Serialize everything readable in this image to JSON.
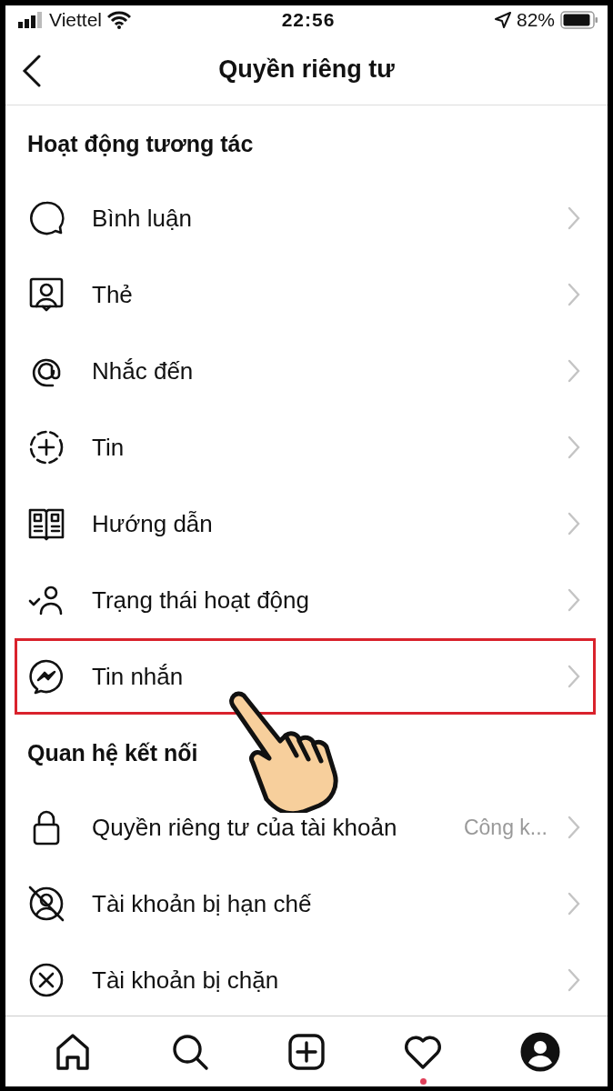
{
  "status_bar": {
    "carrier": "Viettel",
    "time": "22:56",
    "battery": "82%"
  },
  "header": {
    "title": "Quyền riêng tư"
  },
  "sections": [
    {
      "title": "Hoạt động tương tác",
      "items": [
        {
          "kind": "comment",
          "label": "Bình luận",
          "highlighted": false
        },
        {
          "kind": "tag",
          "label": "Thẻ",
          "highlighted": false
        },
        {
          "kind": "mention",
          "label": "Nhắc đến",
          "highlighted": false
        },
        {
          "kind": "story",
          "label": "Tin",
          "highlighted": false
        },
        {
          "kind": "guide",
          "label": "Hướng dẫn",
          "highlighted": false
        },
        {
          "kind": "activity",
          "label": "Trạng thái hoạt động",
          "highlighted": false
        },
        {
          "kind": "messenger",
          "label": "Tin nhắn",
          "highlighted": true
        }
      ]
    },
    {
      "title": "Quan hệ kết nối",
      "items": [
        {
          "kind": "lock",
          "label": "Quyền riêng tư của tài khoản",
          "value": "Công k...",
          "highlighted": false
        },
        {
          "kind": "restricted",
          "label": "Tài khoản bị hạn chế",
          "highlighted": false
        },
        {
          "kind": "blocked",
          "label": "Tài khoản bị chặn",
          "highlighted": false
        }
      ]
    }
  ],
  "tab_bar": [
    {
      "kind": "home",
      "selected": false
    },
    {
      "kind": "search",
      "selected": false
    },
    {
      "kind": "create",
      "selected": false
    },
    {
      "kind": "heart",
      "selected": false,
      "notification": true
    },
    {
      "kind": "profile",
      "selected": true
    }
  ]
}
